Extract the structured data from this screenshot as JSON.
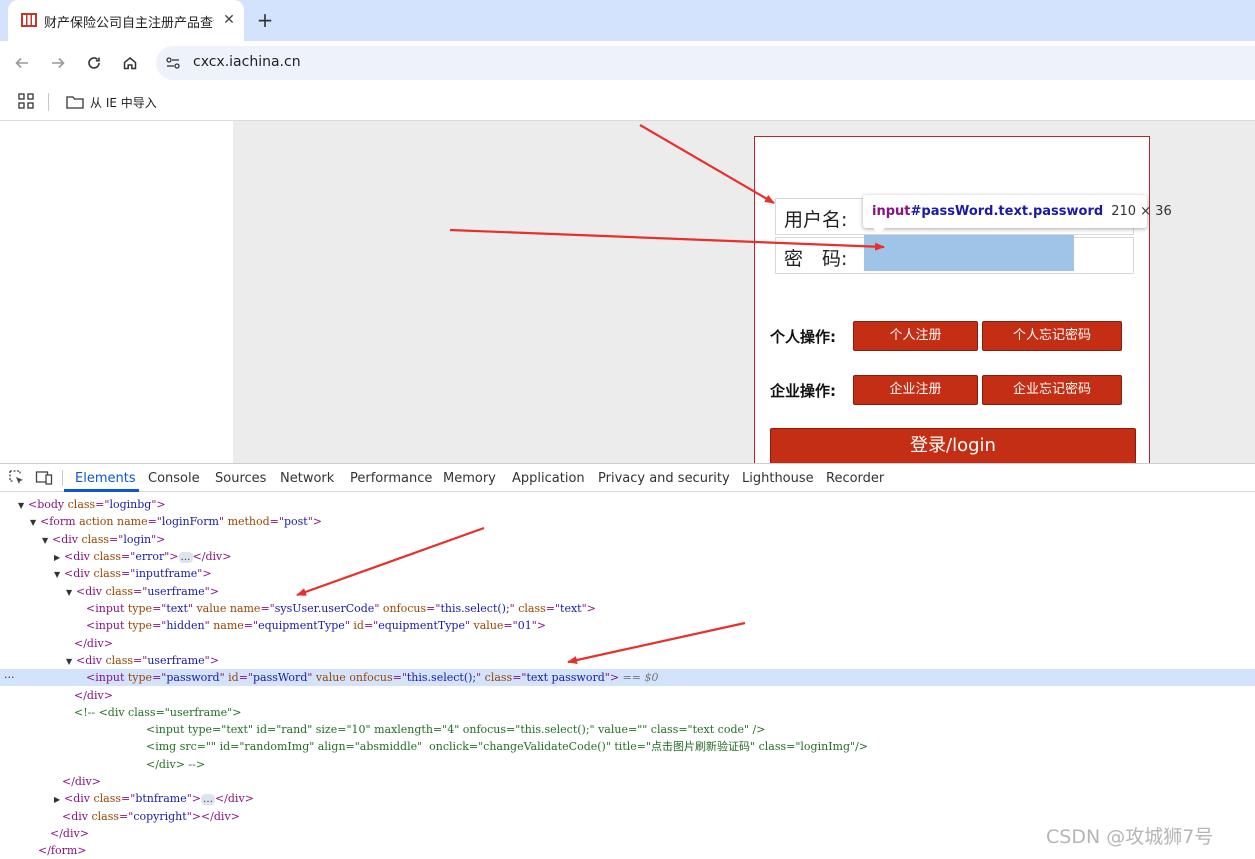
{
  "browser": {
    "tab_title": "财产保险公司自主注册产品查询",
    "tab_close": "✕",
    "new_tab": "+",
    "url": "cxcx.iachina.cn",
    "bookmark_label": "从 IE 中导入"
  },
  "page": {
    "username_label": "用户名:",
    "password_label": "密　码:",
    "personal_ops_label": "个人操作:",
    "personal_register": "个人注册",
    "personal_forgot": "个人忘记密码",
    "company_ops_label": "企业操作:",
    "company_register": "企业注册",
    "company_forgot": "企业忘记密码",
    "login_button": "登录/login"
  },
  "tooltip": {
    "tag": "input",
    "selector": "#passWord.text.password",
    "size": "210 × 36"
  },
  "devtools": {
    "tabs": [
      "Elements",
      "Console",
      "Sources",
      "Network",
      "Performance",
      "Memory",
      "Application",
      "Privacy and security",
      "Lighthouse",
      "Recorder"
    ],
    "active_tab": "Elements",
    "selected_suffix": "== $0",
    "dom": {
      "l1": {
        "tag": "body",
        "attrs": [
          [
            "class",
            "loginbg"
          ]
        ]
      },
      "l2": {
        "tag": "form",
        "attrs": [
          [
            "action",
            null
          ],
          [
            "name",
            "loginForm"
          ],
          [
            "method",
            "post"
          ]
        ]
      },
      "l3": {
        "tag": "div",
        "attrs": [
          [
            "class",
            "login"
          ]
        ]
      },
      "l4": {
        "tag": "div",
        "attrs": [
          [
            "class",
            "error"
          ]
        ],
        "close": "</div>"
      },
      "l5": {
        "tag": "div",
        "attrs": [
          [
            "class",
            "inputframe"
          ]
        ]
      },
      "l6": {
        "tag": "div",
        "attrs": [
          [
            "class",
            "userframe"
          ]
        ]
      },
      "l7": {
        "tag": "input",
        "attrs": [
          [
            "type",
            "text"
          ],
          [
            "value",
            null
          ],
          [
            "name",
            "sysUser.userCode"
          ],
          [
            "onfocus",
            "this.select();"
          ],
          [
            "class",
            "text"
          ]
        ]
      },
      "l8": {
        "tag": "input",
        "attrs": [
          [
            "type",
            "hidden"
          ],
          [
            "name",
            "equipmentType"
          ],
          [
            "id",
            "equipmentType"
          ],
          [
            "value",
            "01"
          ]
        ]
      },
      "l9": "</div>",
      "l10": {
        "tag": "div",
        "attrs": [
          [
            "class",
            "userframe"
          ]
        ]
      },
      "l11": {
        "tag": "input",
        "attrs": [
          [
            "type",
            "password"
          ],
          [
            "id",
            "passWord"
          ],
          [
            "value",
            null
          ],
          [
            "onfocus",
            "this.select();"
          ],
          [
            "class",
            "text password"
          ]
        ]
      },
      "l12": "</div>",
      "l13": "<!-- <div class=\"userframe\">",
      "l14": "<input type=\"text\" id=\"rand\" size=\"10\" maxlength=\"4\" onfocus=\"this.select();\" value=\"\" class=\"text code\" />",
      "l15": "<img src=\"\" id=\"randomImg\" align=\"absmiddle\"  onclick=\"changeValidateCode()\" title=\"点击图片刷新验证码\" class=\"loginImg\"/>",
      "l16": "</div> -->",
      "l17": "</div>",
      "l18": {
        "tag": "div",
        "attrs": [
          [
            "class",
            "btnframe"
          ]
        ],
        "close": "</div>"
      },
      "l19": {
        "tag": "div",
        "attrs": [
          [
            "class",
            "copyright"
          ]
        ],
        "close": "</div>"
      },
      "l20": "</div>",
      "l21": "</form>"
    }
  },
  "watermark": "CSDN @攻城狮7号",
  "colors": {
    "arrow": "#e8302a",
    "button_red": "#c42e14",
    "devtools_blue": "#0b57d0"
  }
}
